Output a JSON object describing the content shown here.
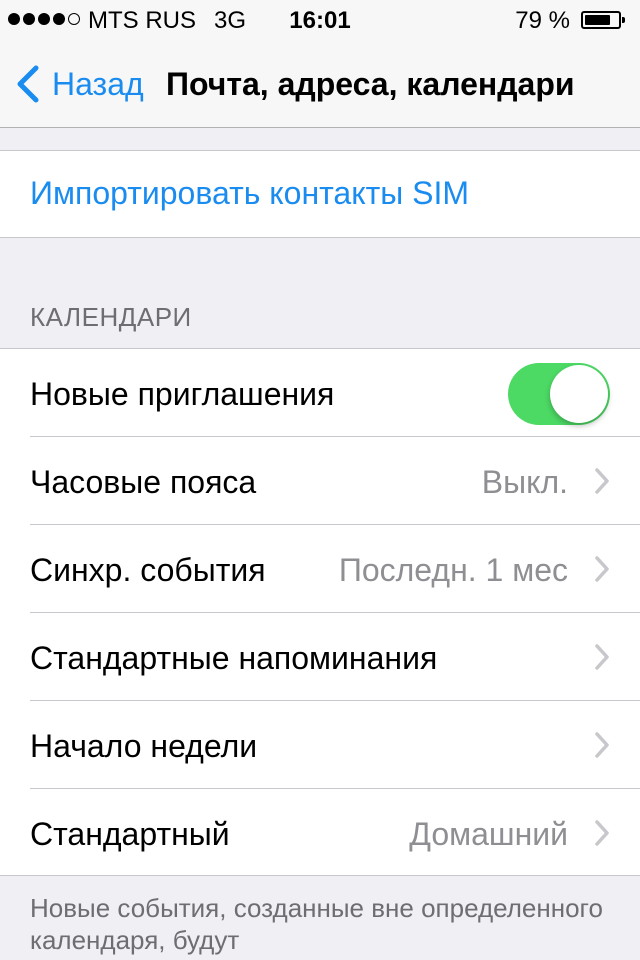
{
  "status_bar": {
    "carrier": "MTS RUS",
    "network": "3G",
    "time": "16:01",
    "battery_percent_text": "79 %",
    "signal_bars_filled": 4,
    "signal_bars_total": 5,
    "battery_level": 0.79
  },
  "nav": {
    "back_label": "Назад",
    "title": "Почта, адреса, календари"
  },
  "import": {
    "label": "Импортировать контакты SIM"
  },
  "calendars": {
    "header": "КАЛЕНДАРИ",
    "rows": [
      {
        "label": "Новые приглашения",
        "type": "toggle",
        "on": true
      },
      {
        "label": "Часовые пояса",
        "value": "Выкл."
      },
      {
        "label": "Синхр. события",
        "value": "Последн. 1 мес"
      },
      {
        "label": "Стандартные напоминания",
        "value": ""
      },
      {
        "label": "Начало недели",
        "value": ""
      },
      {
        "label": "Стандартный",
        "value": "Домашний"
      }
    ]
  },
  "footer": {
    "note": "Новые события, созданные вне определенного календаря, будут"
  },
  "colors": {
    "accent": "#1a8cf0",
    "toggle_on": "#4cd964",
    "background": "#efeff4",
    "secondary_text": "#8e8e93"
  }
}
